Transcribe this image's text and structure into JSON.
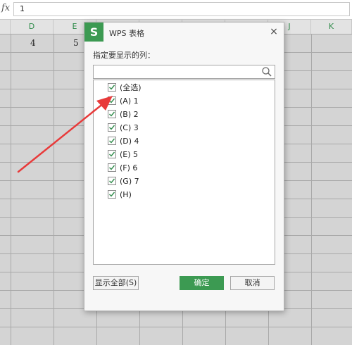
{
  "formula_bar": {
    "fx_label": "fx",
    "value": "1"
  },
  "columns": [
    "D",
    "E",
    "J",
    "K"
  ],
  "cells": {
    "d1": "4",
    "e1": "5"
  },
  "dialog": {
    "title": "WPS 表格",
    "logo_letter": "S",
    "close_label": "×",
    "prompt": "指定要显示的列：",
    "search_value": "",
    "items": [
      {
        "label": "(全选)",
        "checked": true
      },
      {
        "label": "(A) 1",
        "checked": true
      },
      {
        "label": "(B) 2",
        "checked": true
      },
      {
        "label": "(C) 3",
        "checked": true
      },
      {
        "label": "(D) 4",
        "checked": true
      },
      {
        "label": "(E) 5",
        "checked": true
      },
      {
        "label": "(F) 6",
        "checked": true
      },
      {
        "label": "(G) 7",
        "checked": true
      },
      {
        "label": "(H)",
        "checked": true
      }
    ],
    "show_all_label": "显示全部(S)",
    "ok_label": "确定",
    "cancel_label": "取消"
  },
  "colors": {
    "accent": "#3c9a52",
    "annotation": "#e83a3a"
  }
}
